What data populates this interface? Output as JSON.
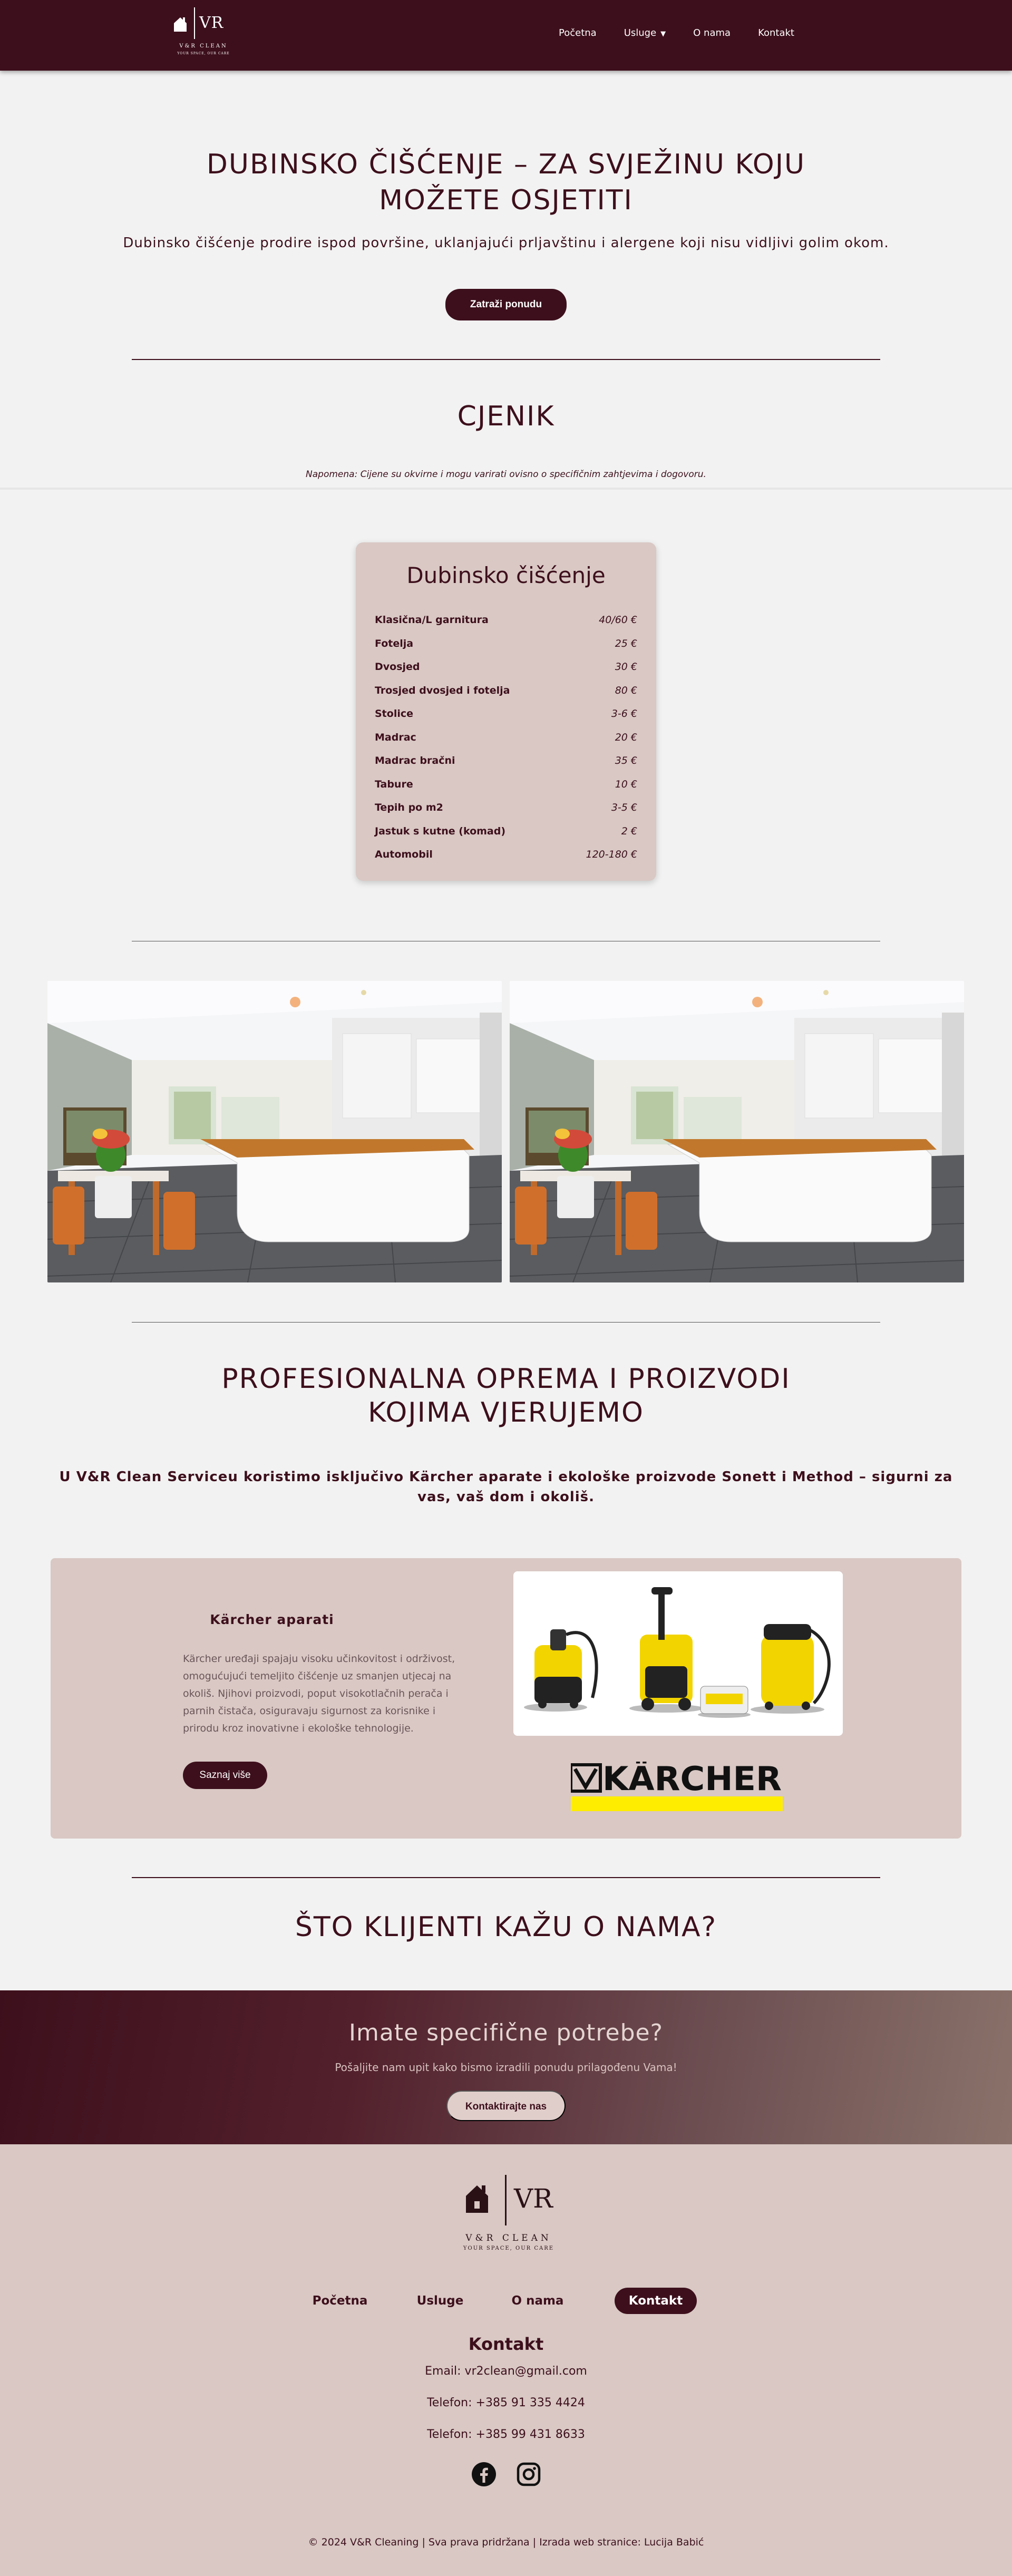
{
  "nav": {
    "logo": {
      "vr": "VR",
      "brand": "V&R CLEAN",
      "tagline": "YOUR SPACE, OUR CARE"
    },
    "links": [
      {
        "label": "Početna"
      },
      {
        "label": "Usluge",
        "caret": "▼"
      },
      {
        "label": "O nama"
      },
      {
        "label": "Kontakt"
      }
    ]
  },
  "hero": {
    "title_line1": "DUBINSKO ČIŠĆENJE – ZA SVJEŽINU KOJU",
    "title_line2": "MOŽETE OSJETITI",
    "subtitle": "Dubinsko čišćenje prodire ispod površine, uklanjajući prljavštinu i alergene koji nisu vidljivi golim okom.",
    "cta_label": "Zatraži ponudu"
  },
  "pricing": {
    "title": "CJENIK",
    "note": "Napomena: Cijene su okvirne i mogu varirati ovisno o specifičnim zahtjevima i dogovoru.",
    "card_title": "Dubinsko čišćenje",
    "items": [
      {
        "name": "Klasična/L garnitura",
        "price": "40/60 €"
      },
      {
        "name": "Fotelja",
        "price": "25 €"
      },
      {
        "name": "Dvosjed",
        "price": "30 €"
      },
      {
        "name": "Trosjed dvosjed i fotelja",
        "price": "80 €"
      },
      {
        "name": "Stolice",
        "price": "3-6 €"
      },
      {
        "name": "Madrac",
        "price": "20 €"
      },
      {
        "name": "Madrac bračni",
        "price": "35 €"
      },
      {
        "name": "Tabure",
        "price": "10 €"
      },
      {
        "name": "Tepih po m2",
        "price": "3-5 €"
      },
      {
        "name": "Jastuk s kutne (komad)",
        "price": "2 €"
      },
      {
        "name": "Automobil",
        "price": "120-180 €"
      }
    ]
  },
  "equipment": {
    "title_line1": "PROFESIONALNA OPREMA I PROIZVODI",
    "title_line2": "KOJIMA VJERUJEMO",
    "intro": "U V&R Clean Serviceu koristimo isključivo Kärcher aparate i ekološke proizvode Sonett i Method – sigurni za vas, vaš dom i okoliš.",
    "card_title": "Kärcher aparati",
    "card_text": "Kärcher uređaji spajaju visoku učinkovitost i održivost, omogućujući temeljito čišćenje uz smanjen utjecaj na okoliš. Njihovi proizvodi, poput visokotlačnih perača i parnih čistača, osiguravaju sigurnost za korisnike i prirodu kroz inovativne i ekološke tehnologije.",
    "card_button": "Saznaj više",
    "brand_logo_text": "KÄRCHER"
  },
  "reviews": {
    "title": "ŠTO KLIJENTI KAŽU O NAMA?"
  },
  "cta": {
    "title": "Imate specifične potrebe?",
    "text": "Pošaljite nam upit kako bismo izradili ponudu prilagođenu Vama!",
    "button": "Kontaktirajte nas"
  },
  "footer": {
    "logo": {
      "vr": "VR",
      "brand": "V&R CLEAN",
      "tagline": "YOUR SPACE, OUR CARE"
    },
    "nav": [
      {
        "label": "Početna"
      },
      {
        "label": "Usluge"
      },
      {
        "label": "O nama"
      },
      {
        "label": "Kontakt",
        "active": true
      }
    ],
    "contact_title": "Kontakt",
    "email": "Email: vr2clean@gmail.com",
    "phone1": "Telefon: +385 91 335 4424",
    "phone2": "Telefon: +385 99 431 8633",
    "social": [
      "facebook-icon",
      "instagram-icon"
    ],
    "copyright": "© 2024 V&R Cleaning | Sva prava pridržana | Izrada web stranice: Lucija Babić"
  },
  "colors": {
    "primary": "#3d0f1c",
    "card_bg": "#d9c8c4",
    "page_bg": "#f2f2f2"
  }
}
